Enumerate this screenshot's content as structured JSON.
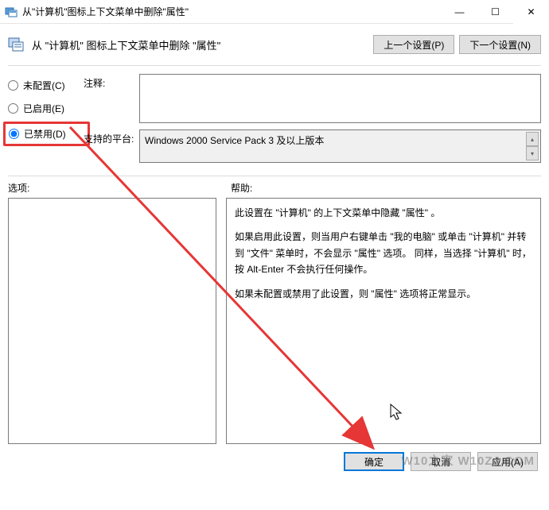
{
  "window": {
    "title": "从\"计算机\"图标上下文菜单中删除\"属性\"",
    "minimize_glyph": "—",
    "maximize_glyph": "☐",
    "close_glyph": "✕"
  },
  "header": {
    "policy_name": "从 \"计算机\" 图标上下文菜单中删除 \"属性\"",
    "prev_setting": "上一个设置(P)",
    "next_setting": "下一个设置(N)"
  },
  "radios": {
    "not_configured": "未配置(C)",
    "enabled": "已启用(E)",
    "disabled": "已禁用(D)",
    "selected": "disabled"
  },
  "fields": {
    "comment_label": "注释:",
    "comment_value": "",
    "platform_label": "支持的平台:",
    "platform_value": "Windows 2000 Service Pack 3 及以上版本"
  },
  "labels": {
    "options": "选项:",
    "help": "帮助:"
  },
  "help": {
    "p1": "此设置在 \"计算机\" 的上下文菜单中隐藏 \"属性\" 。",
    "p2": "如果启用此设置，则当用户右键单击 \"我的电脑\" 或单击 \"计算机\" 并转到 \"文件\" 菜单时，不会显示 \"属性\" 选项。 同样，当选择 \"计算机\" 时，按 Alt-Enter 不会执行任何操作。",
    "p3": "如果未配置或禁用了此设置，则 \"属性\" 选项将正常显示。"
  },
  "footer": {
    "ok": "确定",
    "cancel": "取消",
    "apply": "应用(A)"
  },
  "watermark": "W10之家 W10ZJ.COM"
}
